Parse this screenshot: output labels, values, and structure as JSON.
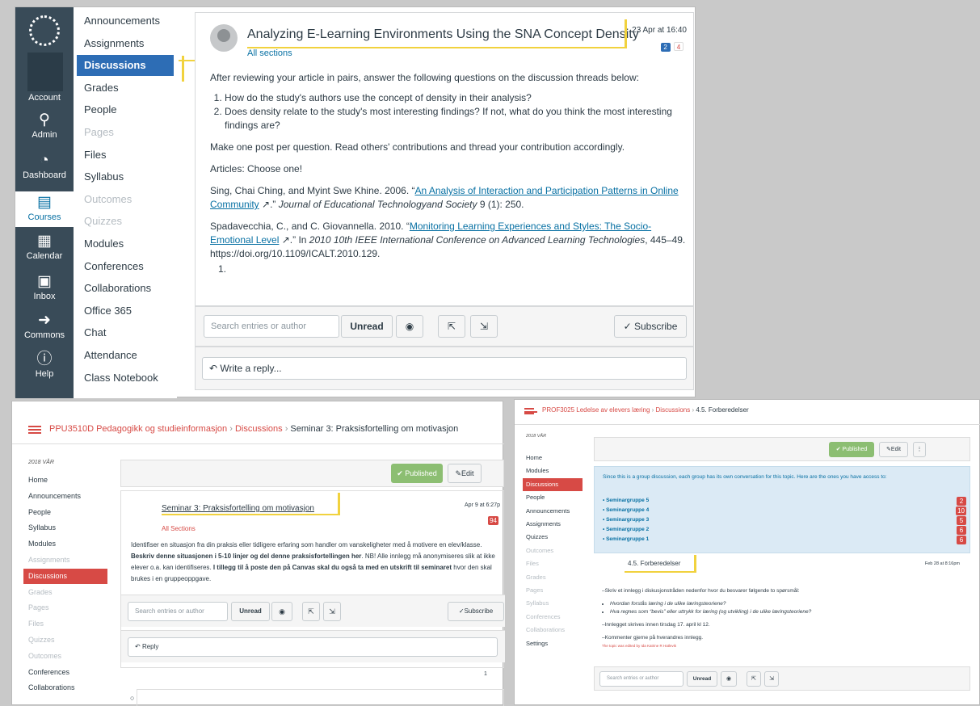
{
  "top": {
    "global_nav": {
      "items": [
        "Account",
        "Admin",
        "Dashboard",
        "Courses",
        "Calendar",
        "Inbox",
        "Commons",
        "Help"
      ]
    },
    "course_nav": [
      {
        "label": "Announcements",
        "state": "normal"
      },
      {
        "label": "Assignments",
        "state": "normal"
      },
      {
        "label": "Discussions",
        "state": "active"
      },
      {
        "label": "Grades",
        "state": "normal"
      },
      {
        "label": "People",
        "state": "normal"
      },
      {
        "label": "Pages",
        "state": "muted"
      },
      {
        "label": "Files",
        "state": "normal"
      },
      {
        "label": "Syllabus",
        "state": "normal"
      },
      {
        "label": "Outcomes",
        "state": "muted"
      },
      {
        "label": "Quizzes",
        "state": "muted"
      },
      {
        "label": "Modules",
        "state": "normal"
      },
      {
        "label": "Conferences",
        "state": "normal"
      },
      {
        "label": "Collaborations",
        "state": "normal"
      },
      {
        "label": "Office 365",
        "state": "normal"
      },
      {
        "label": "Chat",
        "state": "normal"
      },
      {
        "label": "Attendance",
        "state": "normal"
      },
      {
        "label": "Class Notebook",
        "state": "normal"
      }
    ],
    "topic": {
      "title": "Analyzing E-Learning Environments Using the SNA Concept Density",
      "date": "23 Apr at 16:40",
      "badge_unread": "2",
      "badge_total": "4",
      "sections": "All sections",
      "intro": "After reviewing your article in pairs, answer the following questions on the discussion threads below:",
      "questions": [
        "How do the study's authors use the concept of density in their analysis?",
        "Does density relate to the study's most interesting findings? If not, what do you think the most interesting findings are?"
      ],
      "instruction": "Make one post per question. Read others' contributions and thread your contribution accordingly.",
      "articles_label": "Articles: Choose one!",
      "ref1_pre": "Sing, Chai Ching, and Myint Swe Khine. 2006. “",
      "ref1_link": "An Analysis of Interaction and Participation Patterns in Online Community",
      "ref1_post": ".” ",
      "ref1_journal": "Journal of Educational Technologyand Society",
      "ref1_tail": " 9 (1): 250.",
      "ref2_pre": "Spadavecchia, C., and C. Giovannella. 2010. “",
      "ref2_link": "Monitoring Learning Experiences and Styles: The Socio-Emotional Level",
      "ref2_post": ".” In ",
      "ref2_journal": "2010 10th IEEE International Conference on Advanced Learning Technologies",
      "ref2_tail": ", 445–49.",
      "ref2_doi": "https://doi.org/10.1109/ICALT.2010.129.",
      "list_tail": "1."
    },
    "toolbar": {
      "search_placeholder": "Search entries or author",
      "unread": "Unread",
      "subscribe": "Subscribe"
    },
    "reply": "Write a reply..."
  },
  "bottom_left": {
    "breadcrumb": [
      "PPU3510D Pedagogikk og studieinformasjon",
      "Discussions",
      "Seminar 3: Praksisfortelling om motivasjon"
    ],
    "term": "2018 VÅR",
    "nav": [
      {
        "label": "Home",
        "state": "normal"
      },
      {
        "label": "Announcements",
        "state": "normal"
      },
      {
        "label": "People",
        "state": "normal"
      },
      {
        "label": "Syllabus",
        "state": "normal"
      },
      {
        "label": "Modules",
        "state": "normal"
      },
      {
        "label": "Assignments",
        "state": "muted"
      },
      {
        "label": "Discussions",
        "state": "active"
      },
      {
        "label": "Grades",
        "state": "muted"
      },
      {
        "label": "Pages",
        "state": "muted"
      },
      {
        "label": "Files",
        "state": "muted"
      },
      {
        "label": "Quizzes",
        "state": "muted"
      },
      {
        "label": "Outcomes",
        "state": "muted"
      },
      {
        "label": "Conferences",
        "state": "normal"
      },
      {
        "label": "Collaborations",
        "state": "normal"
      }
    ],
    "published": "Published",
    "edit": "Edit",
    "title": "Seminar 3: Praksisfortelling om motivasjon",
    "date": "Apr 9 at 6:27p",
    "badge": "94",
    "sections": "All Sections",
    "body_1": "Identifiser en situasjon fra din praksis eller tidligere erfaring som handler om vanskeligheter med å motivere en elev/klasse. ",
    "body_bold1": "Beskriv denne situasjonen i 5-10 linjer og del denne praksisfortellingen her",
    "body_2": ". NB! Alle innlegg må anonymiseres slik at ikke elever o.a. kan identifiseres.  ",
    "body_bold2": "I tillegg til å poste den på Canvas skal du også ta med en utskrift til seminaret",
    "body_3": " hvor den skal brukes i en gruppeoppgave.",
    "search_placeholder": "Search entries or author",
    "unread": "Unread",
    "subscribe": "Subscribe",
    "reply": "Reply",
    "page": "1"
  },
  "bottom_right": {
    "breadcrumb": [
      "PROF3025 Ledelse av elevers læring",
      "Discussions",
      "4.5. Forberedelser"
    ],
    "term": "2018 VÅR",
    "nav": [
      {
        "label": "Home",
        "state": "normal"
      },
      {
        "label": "Modules",
        "state": "normal"
      },
      {
        "label": "Discussions",
        "state": "active"
      },
      {
        "label": "People",
        "state": "normal"
      },
      {
        "label": "Announcements",
        "state": "normal"
      },
      {
        "label": "Assignments",
        "state": "normal"
      },
      {
        "label": "Quizzes",
        "state": "normal"
      },
      {
        "label": "Outcomes",
        "state": "muted"
      },
      {
        "label": "Files",
        "state": "muted"
      },
      {
        "label": "Grades",
        "state": "muted"
      },
      {
        "label": "Pages",
        "state": "muted"
      },
      {
        "label": "Syllabus",
        "state": "muted"
      },
      {
        "label": "Conferences",
        "state": "muted"
      },
      {
        "label": "Collaborations",
        "state": "muted"
      },
      {
        "label": "Settings",
        "state": "normal"
      }
    ],
    "published": "Published",
    "edit": "Edit",
    "group_notice": "Since this is a group discussion, each group has its own conversation for this topic. Here are the ones you have access to:",
    "groups": [
      {
        "name": "Seminargruppe 5",
        "unread": "2",
        "total": "2"
      },
      {
        "name": "Seminargruppe 4",
        "unread": "10",
        "total": "10"
      },
      {
        "name": "Seminargruppe 3",
        "unread": "5",
        "total": "5"
      },
      {
        "name": "Seminargruppe 2",
        "unread": "6",
        "total": "6"
      },
      {
        "name": "Seminargruppe 1",
        "unread": "6",
        "total": "6"
      }
    ],
    "title": "4.5. Forberedelser",
    "date": "Feb 28 at 8:16pm",
    "line1": "–Skriv et innlegg i diskusjonstråden nedenfor hvor du besvarer følgende to spørsmål:",
    "bullets": [
      "Hvordan forstås læring i de ulike læringsteoriene?",
      "Hva regnes som “bevis” eller uttrykk for læring (og utvikling) i de ulike læringsteoriene?"
    ],
    "line2": "–Innlegget skrives innen tirsdag 17. april kl 12.",
    "line3": "–Kommenter gjerne på hverandres innlegg.",
    "edited": "The topic was edited by Ida Katrine R Hatlevik",
    "search_placeholder": "Search entries or author",
    "unread": "Unread"
  },
  "colors": {
    "canvas_nav": "#394b58",
    "active_blue": "#2d6db5",
    "canvas_red": "#d74a45",
    "highlight": "#f1d23e",
    "link": "#0770a3"
  }
}
